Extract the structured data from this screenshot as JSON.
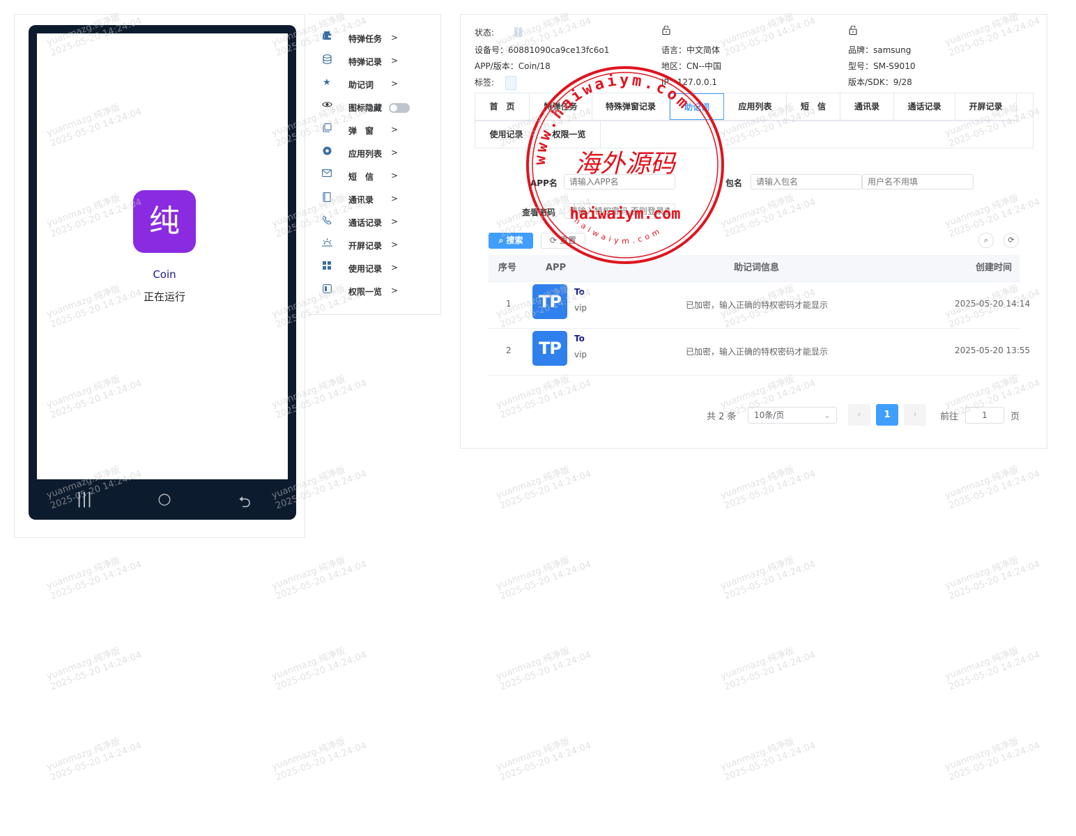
{
  "phone": {
    "app_icon_char": "纯",
    "app_name": "Coin",
    "app_status": "正在运行",
    "nav_recent": "|||",
    "nav_home": "○",
    "nav_back": "⮌"
  },
  "side_menu": {
    "items": [
      {
        "label": "特弹任务",
        "arrow": ">",
        "icon": "wallet-icon"
      },
      {
        "label": "特弹记录",
        "arrow": ">",
        "icon": "database-icon"
      },
      {
        "label": "助记词",
        "arrow": ">",
        "icon": "star-icon"
      },
      {
        "label": "图标隐藏",
        "arrow": "",
        "icon": "eye-icon",
        "toggle": false
      },
      {
        "label": "弹　窗",
        "arrow": ">",
        "icon": "window-icon"
      },
      {
        "label": "应用列表",
        "arrow": ">",
        "icon": "chrome-icon"
      },
      {
        "label": "短　信",
        "arrow": ">",
        "icon": "mail-icon"
      },
      {
        "label": "通讯录",
        "arrow": ">",
        "icon": "contacts-icon"
      },
      {
        "label": "通话记录",
        "arrow": ">",
        "icon": "phone-icon"
      },
      {
        "label": "开屏记录",
        "arrow": ">",
        "icon": "sunrise-icon"
      },
      {
        "label": "使用记录",
        "arrow": ">",
        "icon": "grid-icon"
      },
      {
        "label": "权限一览",
        "arrow": ">",
        "icon": "switch-icon"
      }
    ]
  },
  "device_info": {
    "status_label": "状态:",
    "device_id": "设备号：60881090ca9ce13fc6o1",
    "app_version": "APP/版本：Coin/18",
    "tag_label": "标签:",
    "language": "语言：中文简体",
    "region": "地区：CN--中国",
    "ip": "IP：127.0.0.1",
    "brand": "品牌：samsung",
    "model": "型号：SM-S9010",
    "sdk": "版本/SDK：9/28"
  },
  "tabs": [
    {
      "label": "首　页",
      "active": false
    },
    {
      "label": "特弹任务",
      "active": false
    },
    {
      "label": "特殊弹窗记录",
      "active": false
    },
    {
      "label": "助记词",
      "active": true
    },
    {
      "label": "应用列表",
      "active": false
    },
    {
      "label": "短　信",
      "active": false
    },
    {
      "label": "通讯录",
      "active": false
    },
    {
      "label": "通话记录",
      "active": false
    },
    {
      "label": "开屏记录",
      "active": false
    },
    {
      "label": "使用记录",
      "active": false
    },
    {
      "label": "权限一览",
      "active": false
    }
  ],
  "filter": {
    "app_name_label": "APP名",
    "app_name_placeholder": "请输入APP名",
    "package_label": "包名",
    "package_placeholder": "请输入包名",
    "user_placeholder": "用户名不用填",
    "password_label": "查看密码",
    "password_placeholder": "请输入特权密码,否则登录查",
    "search_label": "搜索",
    "reset_label": "重置"
  },
  "table": {
    "columns": [
      "序号",
      "APP",
      "助记词信息",
      "创建时间"
    ],
    "rows": [
      {
        "index": "1",
        "app_logo": "TP",
        "app_title": "To",
        "app_sub": "vip",
        "info": "已加密，输入正确的特权密码才能显示",
        "created": "2025-05-20 14:14"
      },
      {
        "index": "2",
        "app_logo": "TP",
        "app_title": "To",
        "app_sub": "vip",
        "info": "已加密，输入正确的特权密码才能显示",
        "created": "2025-05-20 13:55"
      }
    ]
  },
  "pagination": {
    "total": "共 2 条",
    "page_size": "10条/页",
    "current_page": "1",
    "goto_label": "前往",
    "goto_value": "1",
    "page_suffix": "页"
  },
  "stamp": {
    "ring_text": "www.haiwaiym.com",
    "center_text": "海外源码",
    "domain_text": "haiwaiym.com",
    "bottom_text": "haiwaiym.com",
    "color": "#e0141e"
  },
  "watermark": {
    "line1": "yuanmazg.纯净版",
    "line2": "2025-05-20 14:24:04"
  },
  "colors": {
    "primary": "#409eff",
    "phone_frame": "#0d1b2e",
    "app_icon": "#8a2be2",
    "tp_logo": "#2f80ed"
  }
}
